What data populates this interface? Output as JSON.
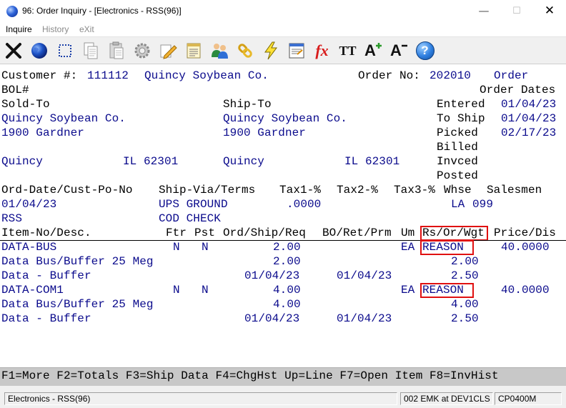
{
  "window": {
    "title": "96: Order Inquiry - [Electronics - RSS(96)]",
    "min_glyph": "—",
    "max_glyph": "☐",
    "close_glyph": "✕"
  },
  "menu": {
    "inquire": "Inquire",
    "history": "History",
    "exit": "eXit"
  },
  "toolbar": {
    "icons": [
      "close-icon",
      "globe-icon",
      "select-icon",
      "copy-icon",
      "paste-icon",
      "settings-icon",
      "edit-icon",
      "notes-icon",
      "users-icon",
      "link-icon",
      "lightning-icon",
      "report-icon",
      "function-icon",
      "font-icon",
      "increase-font-icon",
      "decrease-font-icon",
      "help-icon"
    ],
    "fx_label": "fx",
    "tt_label": "TT",
    "a_label": "A",
    "help_label": "?"
  },
  "header": {
    "customer_label": "Customer #:",
    "customer_no": "111112",
    "customer_name": "Quincy Soybean Co.",
    "order_no_label": "Order No:",
    "order_no": "202010",
    "order_dates_label_1": "Order",
    "order_dates_label_2": "Order Dates",
    "bol_label": "BOL#",
    "sold_to_label": "Sold-To",
    "ship_to_label": "Ship-To",
    "sold_to": {
      "name": "Quincy Soybean Co.",
      "address": "1900 Gardner",
      "city": "Quincy",
      "state_zip": "IL 62301"
    },
    "ship_to": {
      "name": "Quincy Soybean Co.",
      "address": "1900 Gardner",
      "city": "Quincy",
      "state_zip": "IL 62301"
    },
    "dates": {
      "entered_label": "Entered",
      "entered": "01/04/23",
      "to_ship_label": "To Ship",
      "to_ship": "01/04/23",
      "picked_label": "Picked",
      "picked": "02/17/23",
      "billed_label": "Billed",
      "invced_label": "Invced",
      "posted_label": "Posted"
    },
    "col_ord_date": "Ord-Date/Cust-Po-No",
    "col_ship_via": "Ship-Via/Terms",
    "col_tax1": "Tax1-%",
    "col_tax2": "Tax2-%",
    "col_tax3": "Tax3-%",
    "col_whse": "Whse",
    "col_salesmen": "Salesmen",
    "ord_date": "01/04/23",
    "ship_via": "UPS GROUND",
    "tax1": ".0000",
    "whse": "LA",
    "salesman": "099",
    "cust_po": "RSS",
    "terms": "COD CHECK"
  },
  "items_header": {
    "item": "Item-No/Desc.",
    "ftr": "Ftr",
    "pst": "Pst",
    "ord_ship_req": "Ord/Ship/Req",
    "bo_ret_prm": "BO/Ret/Prm",
    "um": "Um",
    "rs_or_wgt": "Rs/Or/Wgt",
    "price_dis": "Price/Dis"
  },
  "items": [
    {
      "item_no": "DATA-BUS",
      "ftr": "N",
      "pst": "N",
      "ord": "2.00",
      "um": "EA",
      "reason": "REASON",
      "price": "40.0000",
      "desc1": "Data Bus/Buffer 25 Meg",
      "ship": "2.00",
      "or": "2.00",
      "desc2": "Data - Buffer",
      "req_date": "01/04/23",
      "prm_date": "01/04/23",
      "wgt": "2.50"
    },
    {
      "item_no": "DATA-COM1",
      "ftr": "N",
      "pst": "N",
      "ord": "4.00",
      "um": "EA",
      "reason": "REASON",
      "price": "40.0000",
      "desc1": "Data Bus/Buffer 25 Meg",
      "ship": "4.00",
      "or": "4.00",
      "desc2": "Data - Buffer",
      "req_date": "01/04/23",
      "prm_date": "01/04/23",
      "wgt": "2.50"
    }
  ],
  "function_keys": "F1=More F2=Totals F3=Ship Data F4=ChgHst Up=Line F7=Open Item F8=InvHist",
  "status": {
    "app": "Electronics - RSS(96)",
    "user": "002 EMK at DEV1CLS",
    "program": "CP0400M"
  },
  "colors": {
    "terminal_blue": "#0a0a8c",
    "highlight_box": "#e01010",
    "fkey_bar": "#c8c8c8"
  }
}
